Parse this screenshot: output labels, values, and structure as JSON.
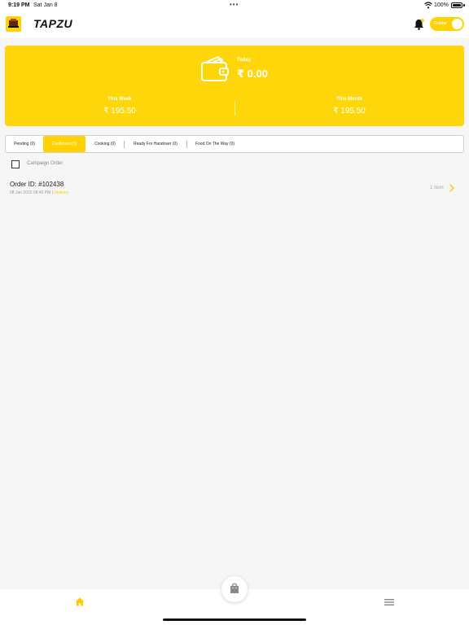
{
  "status_bar": {
    "time": "9:19 PM",
    "date": "Sat Jan 8",
    "battery": "100%"
  },
  "header": {
    "brand": "TAPZU",
    "online_toggle_label": "Online",
    "online": true
  },
  "earnings": {
    "today_label": "Today",
    "today_value": "₹ 0.00",
    "week_label": "This Week",
    "week_value": "₹ 195.50",
    "month_label": "This Month",
    "month_value": "₹ 195.50"
  },
  "tabs": [
    {
      "label": "Pending (0)",
      "active": false
    },
    {
      "label": "Confirmed (1)",
      "active": true
    },
    {
      "label": "Cooking (0)",
      "active": false
    },
    {
      "label": "Ready For Handover (0)",
      "active": false
    },
    {
      "label": "Food On The Way (0)",
      "active": false
    }
  ],
  "filter": {
    "campaign_label": "Campaign Order",
    "checked": false
  },
  "orders": [
    {
      "id": "Order ID: #102438",
      "datetime": "08 Jan 2022  08:40 PM |",
      "status": "Delivery",
      "items": "1 Item"
    }
  ],
  "colors": {
    "accent": "#ffd200",
    "background": "#f6f6f7"
  },
  "icons": {
    "bell": "bell-icon",
    "wallet": "wallet-icon",
    "home": "home-icon",
    "menu": "menu-icon",
    "fab": "shopping-bag-icon"
  }
}
